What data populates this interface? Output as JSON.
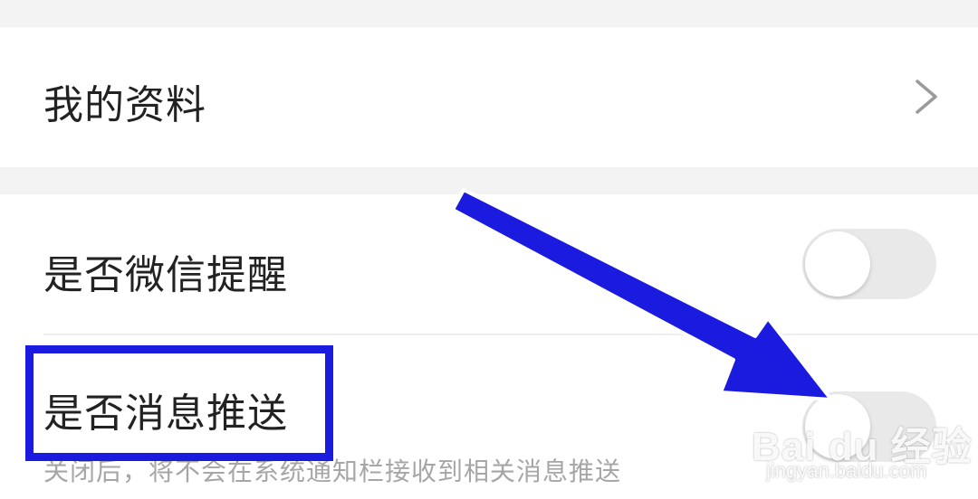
{
  "profile": {
    "label": "我的资料",
    "chevron_icon": "chevron-right-icon"
  },
  "settings": {
    "wechat_reminder": {
      "label": "是否微信提醒",
      "enabled": false
    },
    "message_push": {
      "label": "是否消息推送",
      "enabled": false,
      "hint": "关闭后，将不会在系统通知栏接收到相关消息推送"
    }
  },
  "annotation": {
    "color": "#1b1be0",
    "highlight_target": "是否消息推送",
    "arrow_icon": "arrow-icon"
  },
  "watermark": {
    "brand": "Bai du 经验",
    "url": "jingyan.baidu.com"
  },
  "colors": {
    "background": "#f3f3f3",
    "card": "#ffffff",
    "text": "#222222",
    "hint": "#a6a6a6",
    "toggle_off": "#e9e9e9"
  }
}
